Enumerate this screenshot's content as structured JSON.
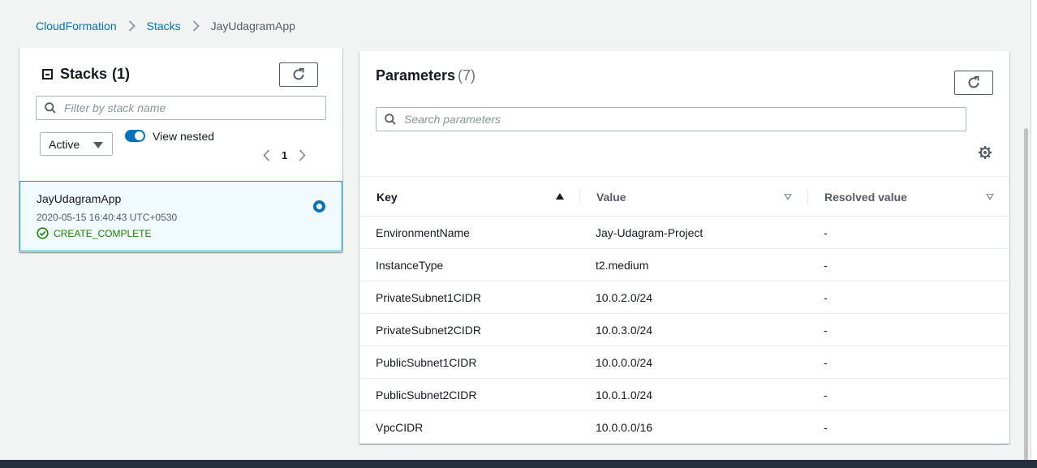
{
  "breadcrumb": {
    "items": [
      "CloudFormation",
      "Stacks"
    ],
    "current": "JayUdagramApp"
  },
  "stacks_panel": {
    "title": "Stacks",
    "count": "(1)",
    "filter_placeholder": "Filter by stack name",
    "status_filter": "Active",
    "view_nested_label": "View nested",
    "view_nested_on": true,
    "page": "1",
    "stack": {
      "name": "JayUdagramApp",
      "created": "2020-05-15 16:40:43 UTC+0530",
      "status": "CREATE_COMPLETE",
      "selected": true
    }
  },
  "parameters_panel": {
    "title": "Parameters",
    "count": "(7)",
    "search_placeholder": "Search parameters",
    "columns": [
      "Key",
      "Value",
      "Resolved value"
    ],
    "rows": [
      {
        "key": "EnvironmentName",
        "value": "Jay-Udagram-Project",
        "resolved": "-"
      },
      {
        "key": "InstanceType",
        "value": "t2.medium",
        "resolved": "-"
      },
      {
        "key": "PrivateSubnet1CIDR",
        "value": "10.0.2.0/24",
        "resolved": "-"
      },
      {
        "key": "PrivateSubnet2CIDR",
        "value": "10.0.3.0/24",
        "resolved": "-"
      },
      {
        "key": "PublicSubnet1CIDR",
        "value": "10.0.0.0/24",
        "resolved": "-"
      },
      {
        "key": "PublicSubnet2CIDR",
        "value": "10.0.1.0/24",
        "resolved": "-"
      },
      {
        "key": "VpcCIDR",
        "value": "10.0.0.0/16",
        "resolved": "-"
      }
    ]
  },
  "colors": {
    "link": "#0073bb",
    "success": "#1d8102",
    "selected_bg": "#f1faff",
    "selected_border": "#00a1c9"
  },
  "icons": [
    "chevron-right-icon",
    "refresh-icon",
    "search-icon",
    "collapse-icon",
    "caret-down-icon",
    "chevron-left-icon",
    "check-circle-icon",
    "settings-gear-icon",
    "sort-ascending-icon",
    "sort-descending-icon"
  ]
}
